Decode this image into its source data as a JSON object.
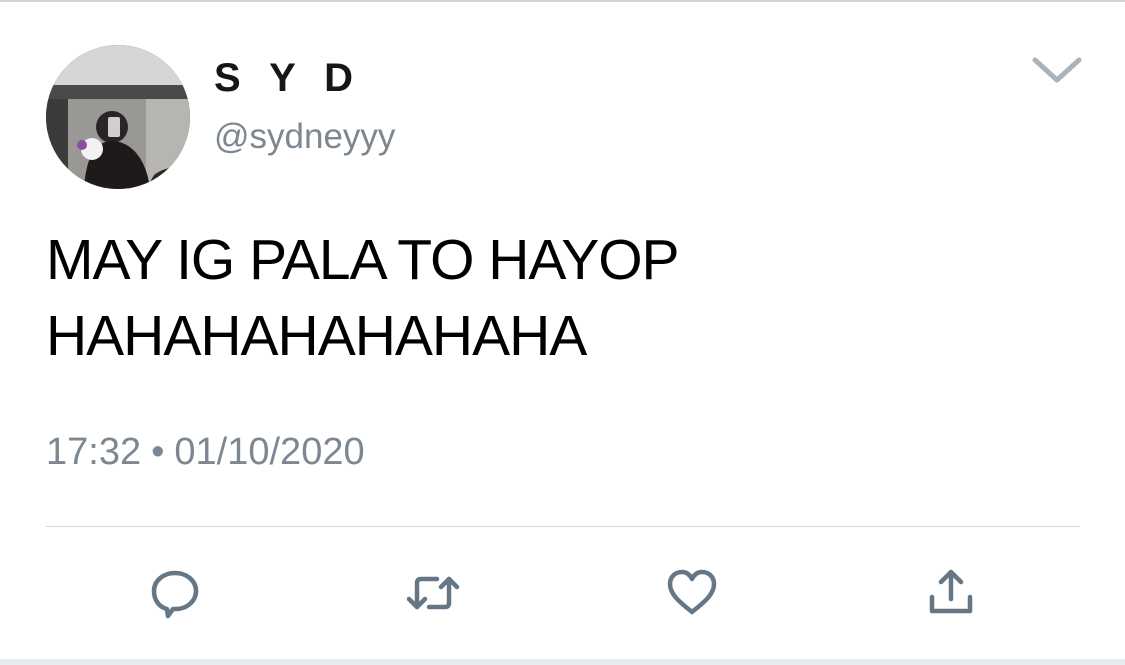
{
  "tweet": {
    "display_name": "S Y D",
    "handle": "@sydneyyy",
    "text_lines": [
      "MAY IG PALA TO HAYOP",
      "HAHAHAHAHAHAHA"
    ],
    "time": "17:32",
    "separator": "•",
    "date": "01/10/2020"
  },
  "icons": {
    "menu": "chevron-down-icon",
    "reply": "reply-icon",
    "retweet": "retweet-icon",
    "like": "heart-icon",
    "share": "share-icon"
  },
  "colors": {
    "text": "#14171a",
    "secondary_text": "#7c8791",
    "icon": "#657786",
    "divider": "#d3d8dc"
  }
}
